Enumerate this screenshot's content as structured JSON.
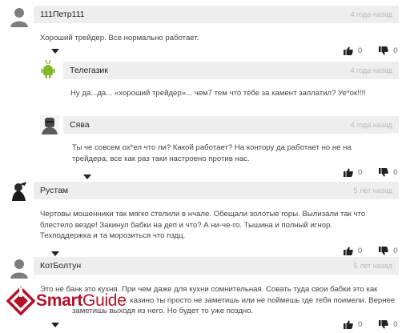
{
  "comments": [
    {
      "author": "111Петр111",
      "date": "4 года назад",
      "text": [
        "Хороший трейдер. Все нормально работает."
      ],
      "likes": "0",
      "dislikes": "0"
    },
    {
      "author": "Телегазик",
      "date": "4 года назад",
      "text": [
        "Ну да...да... «хороший трейдер»... чем7 тем что тебе за камент заплатил? Уе*ок!!!!"
      ]
    },
    {
      "author": "Сява",
      "date": "4 года назад",
      "text": [
        "Ты че совсем ох*ел что ли? Какой работает? На контору да работает но не на",
        "трейдера, все как раз таки настроено против нас."
      ],
      "likes": "0",
      "dislikes": "0"
    },
    {
      "author": "Рустам",
      "date": "5 лет назад",
      "text": [
        "Чертовы мошенники так мягко стелили в нчале. Обещали золотые горы. Вылизали так что",
        "блестело везде! Закинул бабки на деп и что? А ни-че-го. Тышина и полный игнор.",
        "Техподдержка и та морозиться что пздц."
      ],
      "likes": "0",
      "dislikes": "0"
    },
    {
      "author": "КотБолтун",
      "date": "5 лет назад",
      "text": [
        "Это не банк это кухня. При чем даже для кухни сомнительная. Совать туда свои бабки это как",
        "… казино ты просто не заметишь или не поймешь где тебя поимели. Вернее",
        "заметишь выходя из него. Но будет то уже поздно."
      ],
      "likes": "0",
      "dislikes": "0"
    }
  ],
  "icons": {
    "like": "thumbs-up-icon",
    "dislike": "thumbs-down-icon",
    "collapse": "triangle-down-icon"
  },
  "watermark": {
    "part1": "Smart",
    "part2": "Guide",
    "color": "#b5122a"
  }
}
